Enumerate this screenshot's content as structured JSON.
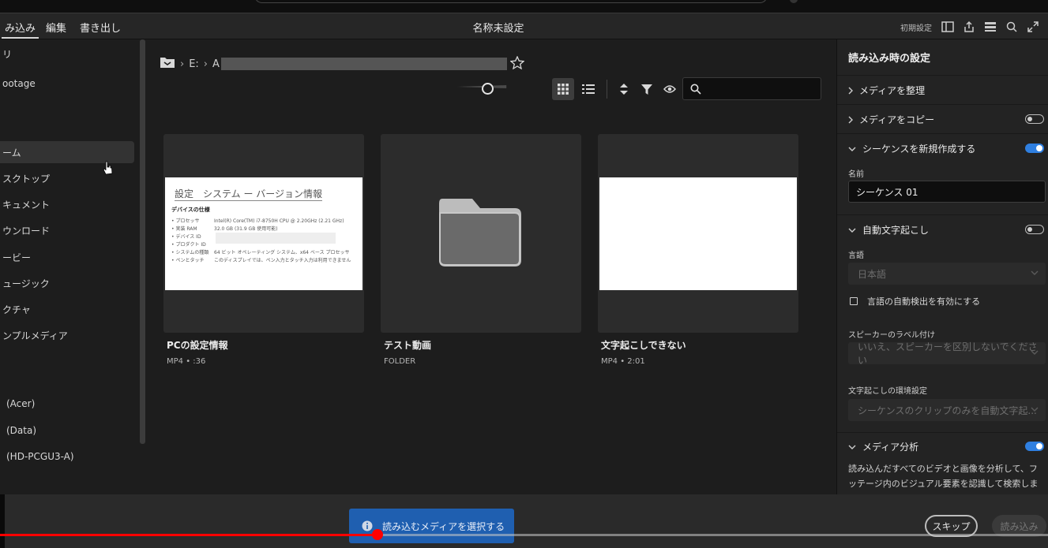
{
  "menubar": {
    "items": [
      "み込み",
      "編集",
      "書き出し"
    ],
    "title": "名称未設定",
    "preset": "初期設定"
  },
  "sidebar": {
    "items": [
      "リ",
      "ootage",
      "ーム",
      "スクトップ",
      "キュメント",
      "ウンロード",
      "ービー",
      "ュージック",
      "クチャ",
      "ンプルメディア",
      "(Acer)",
      "(Data)",
      "(HD-PCGU3-A)"
    ]
  },
  "breadcrumb": {
    "drive": "E:",
    "folder": "A"
  },
  "zoom": {
    "level": 0.55
  },
  "search": {
    "value": "",
    "placeholder": ""
  },
  "cards": [
    {
      "name": "PCの設定情報",
      "meta": "MP4 • :36",
      "type": "video-settings"
    },
    {
      "name": "テスト動画",
      "meta": "FOLDER",
      "type": "folder"
    },
    {
      "name": "文字起こしできない",
      "meta": "MP4 • 2:01",
      "type": "video-white"
    }
  ],
  "thumb_settings": {
    "heading": "設定　システム ー バージョン情報",
    "section": "デバイスの仕様",
    "rows": [
      {
        "label": "• プロセッサ",
        "value": "Intel(R) Core(TM) i7-8750H CPU @ 2.20GHz (2.21 GHz)"
      },
      {
        "label": "• 実装 RAM",
        "value": "32.0 GB (31.9 GB 使用可能)"
      },
      {
        "label": "• デバイス ID",
        "value": ""
      },
      {
        "label": "• プロダクト ID",
        "value": ""
      },
      {
        "label": "• システムの種類",
        "value": "64 ビット オペレーティング システム、x64 ベース プロセッサ"
      },
      {
        "label": "• ペンとタッチ",
        "value": "このディスプレイでは、ペン入力とタッチ入力は利用できません"
      }
    ]
  },
  "panel": {
    "title": "読み込み時の設定",
    "organize": "メディアを整理",
    "copy": "メディアをコピー",
    "sequence": "シーケンスを新規作成する",
    "name_label": "名前",
    "name_value": "シーケンス 01",
    "transcribe": "自動文字起こし",
    "lang_label": "言語",
    "lang_value": "日本語",
    "autodetect": "言語の自動検出を有効にする",
    "speaker_label": "スピーカーのラベル付け",
    "speaker_value": "いいえ、スピーカーを区別しないでください",
    "env_label": "文字起こしの環境設定",
    "env_value": "シーケンスのクリップのみを自動文字起...",
    "analysis": "メディア分析",
    "analysis_desc": "読み込んだすべてのビデオと画像を分析して、フッテージ内のビジュアル要素を認識して検索します。"
  },
  "toggles": {
    "copy": false,
    "sequence": true,
    "transcribe": false,
    "analysis": true
  },
  "footer": {
    "info": "読み込むメディアを選択する",
    "skip": "スキップ",
    "import": "読み込み"
  },
  "video_progress": 0.36,
  "colors": {
    "accent": "#2f7fe0",
    "info_button": "#1f5fb0",
    "progress": "#ff0000"
  }
}
